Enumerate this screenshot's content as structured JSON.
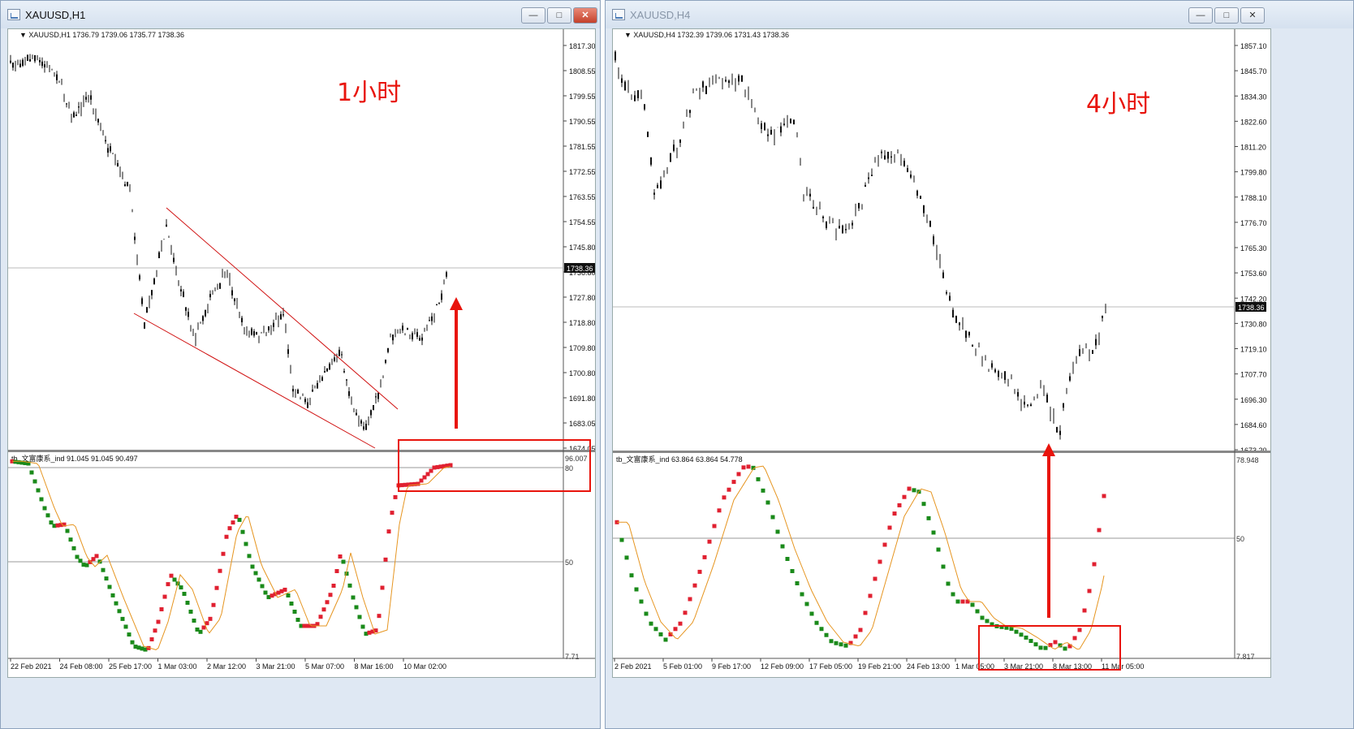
{
  "windows": [
    {
      "id": "h1",
      "title": "XAUUSD,H1",
      "info": "XAUUSD,H1  1736.79 1739.06 1735.77 1738.36",
      "annotation": "1小时",
      "price_ticks": [
        "1817.30",
        "1808.55",
        "1799.55",
        "1790.55",
        "1781.55",
        "1772.55",
        "1763.55",
        "1754.55",
        "1745.80",
        "1736.80",
        "1727.80",
        "1718.80",
        "1709.80",
        "1700.80",
        "1691.80",
        "1683.05",
        "1674.05"
      ],
      "current_price": "1738.36",
      "indicator_label": "tb_文富康系_ind 91.045 91.045 90.497",
      "indicator_ticks": [
        "96.007",
        "80",
        "50",
        "7.71"
      ],
      "time_ticks": [
        "22 Feb 2021",
        "24 Feb 08:00",
        "25 Feb 17:00",
        "1 Mar 03:00",
        "2 Mar 12:00",
        "3 Mar 21:00",
        "5 Mar 07:00",
        "8 Mar 16:00",
        "10 Mar 02:00"
      ]
    },
    {
      "id": "h4",
      "title": "XAUUSD,H4",
      "info": "XAUUSD,H4  1732.39 1739.06 1731.43 1738.36",
      "annotation": "4小时",
      "price_ticks": [
        "1857.10",
        "1845.70",
        "1834.30",
        "1822.60",
        "1811.20",
        "1799.80",
        "1788.10",
        "1776.70",
        "1765.30",
        "1753.60",
        "1742.20",
        "1730.80",
        "1719.10",
        "1707.70",
        "1696.30",
        "1684.60",
        "1673.20"
      ],
      "current_price": "1738.36",
      "indicator_label": "tb_文富康系_ind 63.864 63.864 54.778",
      "indicator_ticks": [
        "78.948",
        "50",
        "7.817"
      ],
      "time_ticks": [
        "2 Feb 2021",
        "5 Feb 01:00",
        "9 Feb 17:00",
        "12 Feb 09:00",
        "17 Feb 05:00",
        "19 Feb 21:00",
        "24 Feb 13:00",
        "1 Mar 05:00",
        "3 Mar 21:00",
        "8 Mar 13:00",
        "11 Mar 05:00"
      ]
    }
  ],
  "colors": {
    "bull": "#1a8a1a",
    "bear": "#e02030",
    "arrow": "#e8140c",
    "trend": "#d01010",
    "signal": "#e69520"
  }
}
